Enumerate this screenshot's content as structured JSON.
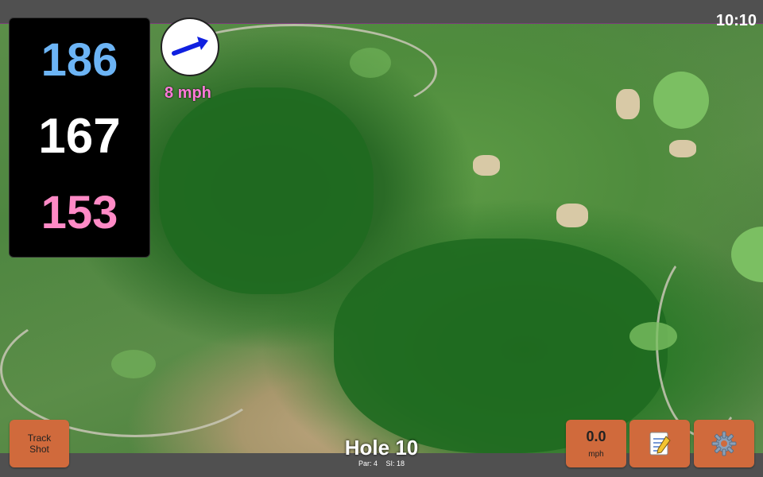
{
  "status": {
    "time": "10:10"
  },
  "distances": {
    "back": "186",
    "middle": "167",
    "front": "153"
  },
  "wind": {
    "speed": "8 mph"
  },
  "buttons": {
    "track_shot": "Track\nShot",
    "speed_value": "0.0",
    "speed_unit": "mph"
  },
  "hole": {
    "title": "Hole 10",
    "par": "Par: 4",
    "si": "SI: 18"
  },
  "icons": {
    "wind": "wind-arrow-icon",
    "notes": "notepad-icon",
    "settings": "gear-icon"
  },
  "colors": {
    "back": "#6cb4f5",
    "middle": "#ffffff",
    "front": "#ff8ac6",
    "button": "#d06a3c",
    "wind_text": "#ff7ad9"
  }
}
